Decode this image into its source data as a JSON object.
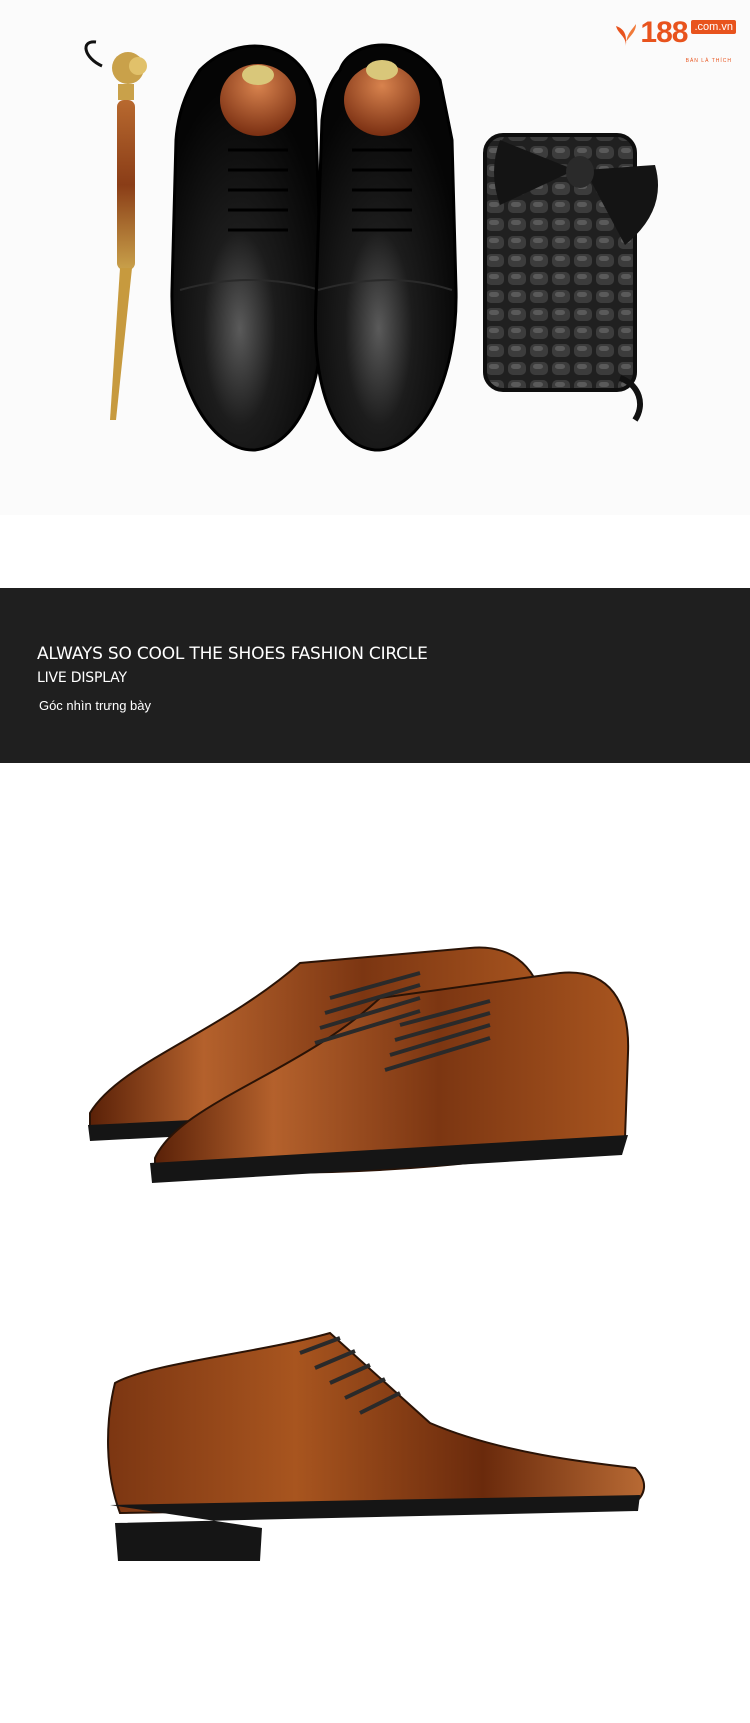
{
  "logo": {
    "number": "188",
    "domain": ".com.vn",
    "tagline": "BÁN LÀ THÍCH"
  },
  "banner": {
    "title": "ALWAYS SO COOL THE SHOES FASHION CIRCLE",
    "subtitle": "LIVE DISPLAY",
    "caption": "Góc nhìn trưng bày"
  },
  "colors": {
    "brand": "#e8531d",
    "banner_bg": "#1f1f1f",
    "shoe_black": "#111111",
    "shoe_brown": "#7a3612"
  },
  "images": {
    "top": "black-oxford-shoes-with-shoehorn-wallet-bowtie",
    "middle": "pair-of-brown-oxford-shoes-angle-view",
    "bottom": "single-brown-oxford-shoe-side-view"
  }
}
